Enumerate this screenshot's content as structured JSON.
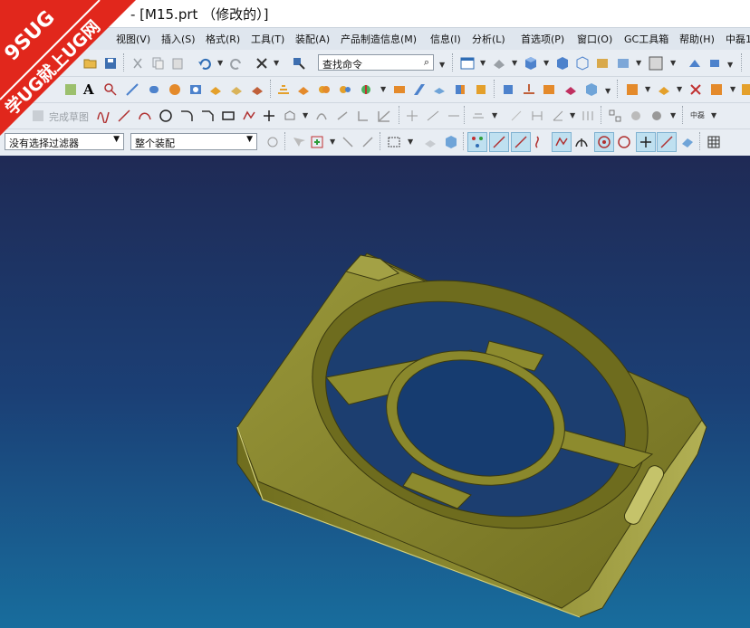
{
  "window": {
    "title": "- [M15.prt （修改的）]"
  },
  "watermark": {
    "line1": "9SUG",
    "line2": "学UG就上UG网",
    "color": "#e1271c"
  },
  "menu": {
    "items": [
      "视图(V)",
      "插入(S)",
      "格式(R)",
      "工具(T)",
      "装配(A)",
      "产品制造信息(M)",
      "信息(I)",
      "分析(L)",
      "首选项(P)",
      "窗口(O)",
      "GC工具箱",
      "帮助(H)",
      "中磊1"
    ]
  },
  "toolbar": {
    "command_search": {
      "value": "查找命令"
    },
    "finish_sketch": {
      "label": "完成草图"
    },
    "selection_filter": {
      "value": "没有选择过滤器"
    },
    "assembly_scope": {
      "value": "整个装配"
    },
    "misc_label": "中磊"
  },
  "viewport": {
    "model_color": "#8c8a2c",
    "background_top": "#1f2a55",
    "background_bottom": "#186d9d"
  }
}
